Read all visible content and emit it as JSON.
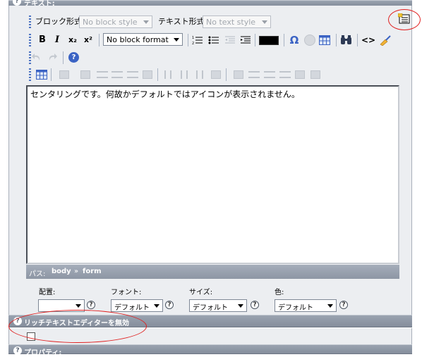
{
  "sections": {
    "text_title": "テキスト:",
    "rich_disable_title": "リッチテキストエディターを無効",
    "property_title": "プロパティ:"
  },
  "toolbar": {
    "block_label": "ブロック形式:",
    "block_value": "No block style",
    "text_label": "テキスト形式:",
    "text_value": "No text style",
    "format_value": "No block format",
    "bold": "B",
    "italic": "I",
    "subscript": "x₂",
    "superscript": "x²",
    "special_char": "Ω",
    "source": "<>"
  },
  "editor": {
    "content": "センタリングです。何故かデフォルトではアイコンが表示されません。"
  },
  "pathbar": {
    "label": "パス:",
    "crumbs": [
      "body",
      "form"
    ],
    "sep": "»"
  },
  "fields": {
    "align_label": "配置:",
    "font_label": "フォント:",
    "size_label": "サイズ:",
    "color_label": "色:",
    "align_value": "",
    "font_value": "デフォルト",
    "size_value": "デフォルト",
    "color_value": "デフォルト"
  },
  "colors": {
    "accent_blue": "#3b63c4",
    "annotation_red": "#e02020",
    "bar_gray": "#8d96a4"
  }
}
